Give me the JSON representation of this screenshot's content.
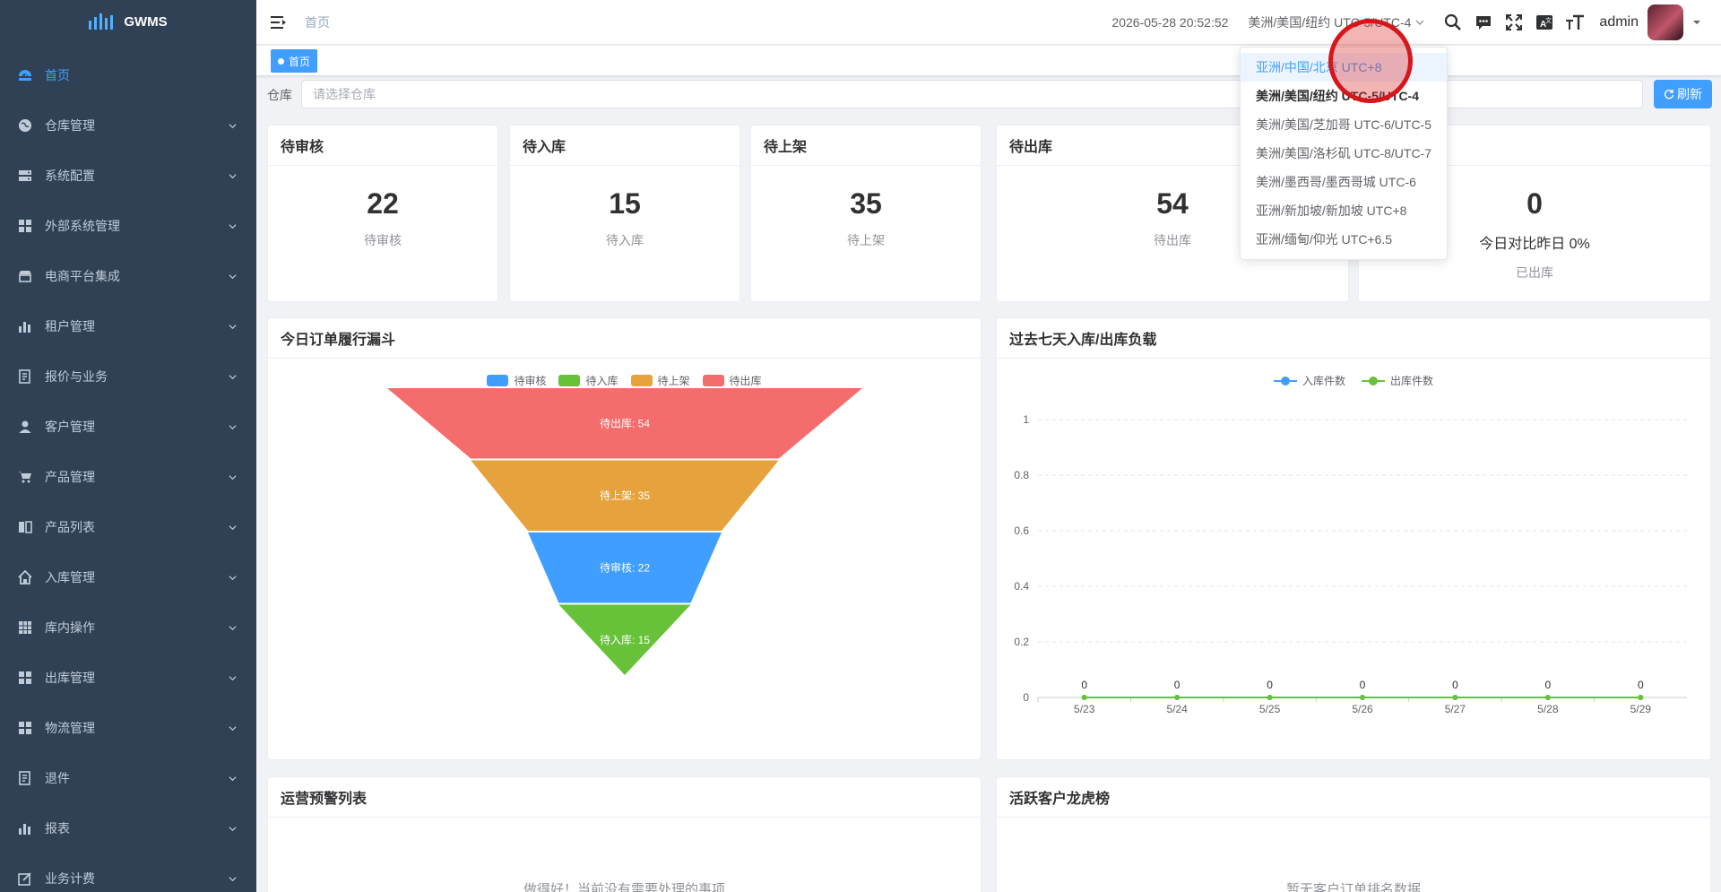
{
  "app": {
    "logo_text": "GWMS"
  },
  "sidebar": {
    "items": [
      {
        "label": "首页",
        "icon": "dashboard-icon",
        "active": true,
        "has_children": false
      },
      {
        "label": "仓库管理",
        "icon": "globe-icon",
        "has_children": true
      },
      {
        "label": "系统配置",
        "icon": "server-icon",
        "has_children": true
      },
      {
        "label": "外部系统管理",
        "icon": "grid-icon",
        "has_children": true
      },
      {
        "label": "电商平台集成",
        "icon": "shop-icon",
        "has_children": true
      },
      {
        "label": "租户管理",
        "icon": "bar-chart-icon",
        "has_children": true
      },
      {
        "label": "报价与业务",
        "icon": "form-icon",
        "has_children": true
      },
      {
        "label": "客户管理",
        "icon": "user-icon",
        "has_children": true
      },
      {
        "label": "产品管理",
        "icon": "cart-icon",
        "has_children": true
      },
      {
        "label": "产品列表",
        "icon": "book-icon",
        "has_children": true
      },
      {
        "label": "入库管理",
        "icon": "home-icon",
        "has_children": true
      },
      {
        "label": "库内操作",
        "icon": "table-icon",
        "has_children": true
      },
      {
        "label": "出库管理",
        "icon": "grid-icon",
        "has_children": true
      },
      {
        "label": "物流管理",
        "icon": "grid-icon",
        "has_children": true
      },
      {
        "label": "退件",
        "icon": "form-icon",
        "has_children": true
      },
      {
        "label": "报表",
        "icon": "bar-chart-icon",
        "has_children": true
      },
      {
        "label": "业务计费",
        "icon": "edit-icon",
        "has_children": true
      }
    ]
  },
  "navbar": {
    "breadcrumb": "首页",
    "datetime": "2026-05-28 20:52:52",
    "timezone": "美洲/美国/纽约 UTC-5/UTC-4",
    "username": "admin"
  },
  "tags": {
    "active": "首页"
  },
  "filter": {
    "label": "仓库",
    "placeholder": "请选择仓库",
    "refresh_label": "刷新"
  },
  "stats": [
    {
      "title": "待审核",
      "value": "22",
      "sub": "待审核"
    },
    {
      "title": "待入库",
      "value": "15",
      "sub": "待入库"
    },
    {
      "title": "待上架",
      "value": "35",
      "sub": "待上架"
    },
    {
      "title": "待出库",
      "value": "54",
      "sub": "待出库"
    },
    {
      "title": "",
      "value": "0",
      "compare": "今日对比昨日 0%",
      "sub": "已出库"
    }
  ],
  "timezone_dropdown": {
    "options": [
      "亚洲/中国/北京 UTC+8",
      "美洲/美国/纽约 UTC-5/UTC-4",
      "美洲/美国/芝加哥 UTC-6/UTC-5",
      "美洲/美国/洛杉矶 UTC-8/UTC-7",
      "美洲/墨西哥/墨西哥城 UTC-6",
      "亚洲/新加坡/新加坡 UTC+8",
      "亚洲/缅甸/仰光 UTC+6.5"
    ],
    "hovered_index": 0,
    "selected_index": 1
  },
  "panels": {
    "funnel_title": "今日订单履行漏斗",
    "load_title": "过去七天入库/出库负载",
    "alerts_title": "运营预警列表",
    "alerts_empty": "做得好！当前没有需要处理的事项",
    "ranking_title": "活跃客户龙虎榜",
    "ranking_empty": "暂无客户订单排名数据"
  },
  "colors": {
    "sidebar_bg": "#304156",
    "primary": "#409eff",
    "funnel": [
      "#409eff",
      "#67c23a",
      "#e6a23c",
      "#f56c6c"
    ],
    "line_in": "#409eff",
    "line_out": "#67c23a"
  },
  "chart_data": [
    {
      "type": "funnel",
      "title": "今日订单履行漏斗",
      "legend": [
        "待审核",
        "待入库",
        "待上架",
        "待出库"
      ],
      "legend_placement": "top-center",
      "series": [
        {
          "name": "待出库",
          "value": 54,
          "label": "待出库: 54"
        },
        {
          "name": "待上架",
          "value": 35,
          "label": "待上架: 35"
        },
        {
          "name": "待审核",
          "value": 22,
          "label": "待审核: 22"
        },
        {
          "name": "待入库",
          "value": 15,
          "label": "待入库: 15"
        }
      ]
    },
    {
      "type": "line",
      "title": "过去七天入库/出库负载",
      "legend_placement": "top-center",
      "categories": [
        "5/23",
        "5/24",
        "5/25",
        "5/26",
        "5/27",
        "5/28",
        "5/29"
      ],
      "series": [
        {
          "name": "入库件数",
          "values": [
            0,
            0,
            0,
            0,
            0,
            0,
            0
          ]
        },
        {
          "name": "出库件数",
          "values": [
            0,
            0,
            0,
            0,
            0,
            0,
            0
          ]
        }
      ],
      "point_labels": [
        "0",
        "0",
        "0",
        "0",
        "0",
        "0",
        "0"
      ],
      "yticks": [
        "0",
        "0.2",
        "0.4",
        "0.6",
        "0.8",
        "1"
      ],
      "ylim": [
        0,
        1
      ],
      "grid": true
    }
  ]
}
